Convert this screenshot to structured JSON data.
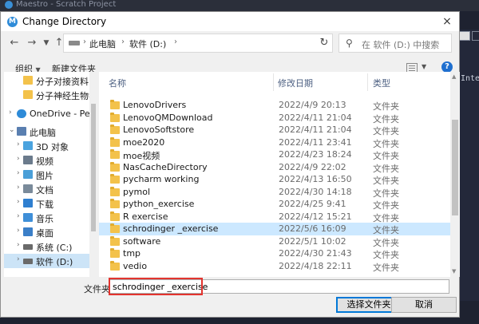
{
  "app": {
    "title": "Maestro - Scratch Project",
    "panel_text": "Inter"
  },
  "dialog": {
    "title": "Change Directory",
    "close_icon": "×",
    "breadcrumb": [
      "此电脑",
      "软件 (D:)"
    ],
    "search_placeholder": "在 软件 (D:) 中搜索",
    "toolbar": {
      "organize": "组织",
      "new_folder": "新建文件夹",
      "help": "?"
    },
    "nav": [
      {
        "label": "分子对接资料",
        "icon": "folder-icon",
        "color": "#f3c24b"
      },
      {
        "label": "分子神经生物学",
        "icon": "folder-icon",
        "color": "#f3c24b"
      },
      {
        "label": "OneDrive - Perso",
        "icon": "cloud-icon",
        "color": "#2e8bd8"
      },
      {
        "label": "此电脑",
        "icon": "computer-icon",
        "color": "#5a7fb0"
      },
      {
        "label": "3D 对象",
        "icon": "cube-icon",
        "color": "#4aa3df"
      },
      {
        "label": "视频",
        "icon": "video-icon",
        "color": "#6b7b8c"
      },
      {
        "label": "图片",
        "icon": "picture-icon",
        "color": "#4a9fd8"
      },
      {
        "label": "文档",
        "icon": "document-icon",
        "color": "#7a8a9a"
      },
      {
        "label": "下载",
        "icon": "download-icon",
        "color": "#2f7fd0"
      },
      {
        "label": "音乐",
        "icon": "music-icon",
        "color": "#3f8fd8"
      },
      {
        "label": "桌面",
        "icon": "desktop-icon",
        "color": "#3b7fc8"
      },
      {
        "label": "系统 (C:)",
        "icon": "drive-icon",
        "color": "#6a6a6a"
      },
      {
        "label": "软件 (D:)",
        "icon": "drive-icon",
        "color": "#6a6a6a"
      }
    ],
    "columns": {
      "name": "名称",
      "date": "修改日期",
      "type": "类型"
    },
    "files": [
      {
        "name": "LenovoDrivers",
        "date": "2022/4/9 20:13",
        "type": "文件夹"
      },
      {
        "name": "LenovoQMDownload",
        "date": "2022/4/11 21:04",
        "type": "文件夹"
      },
      {
        "name": "LenovoSoftstore",
        "date": "2022/4/11 21:04",
        "type": "文件夹"
      },
      {
        "name": "moe2020",
        "date": "2022/4/11 23:41",
        "type": "文件夹"
      },
      {
        "name": "moe视频",
        "date": "2022/4/23 18:24",
        "type": "文件夹"
      },
      {
        "name": "NasCacheDirectory",
        "date": "2022/4/9 22:02",
        "type": "文件夹"
      },
      {
        "name": "pycharm working",
        "date": "2022/4/13 16:50",
        "type": "文件夹"
      },
      {
        "name": "pymol",
        "date": "2022/4/30 14:18",
        "type": "文件夹"
      },
      {
        "name": "python_exercise",
        "date": "2022/4/25 9:41",
        "type": "文件夹"
      },
      {
        "name": "R exercise",
        "date": "2022/4/12 15:21",
        "type": "文件夹"
      },
      {
        "name": "schrodinger _exercise",
        "date": "2022/5/6 16:09",
        "type": "文件夹"
      },
      {
        "name": "software",
        "date": "2022/5/1 10:02",
        "type": "文件夹"
      },
      {
        "name": "tmp",
        "date": "2022/4/30 21:43",
        "type": "文件夹"
      },
      {
        "name": "vedio",
        "date": "2022/4/18 22:11",
        "type": "文件夹"
      }
    ],
    "selected_index": 10,
    "folder_label": "文件夹:",
    "folder_value": "schrodinger _exercise",
    "select_button": "选择文件夹",
    "cancel_button": "取消"
  }
}
